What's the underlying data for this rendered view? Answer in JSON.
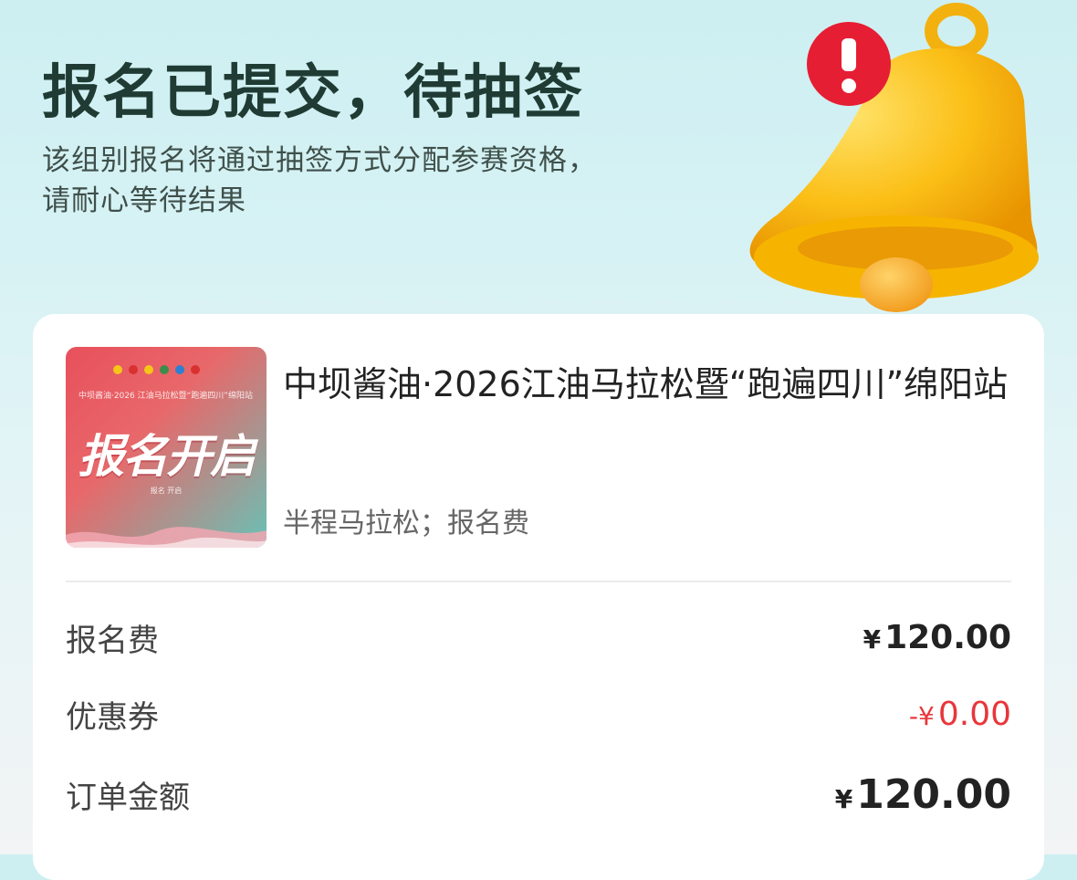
{
  "header": {
    "title": "报名已提交，待抽签",
    "subtitle": "该组别报名将通过抽签方式分配参赛资格，\n请耐心等待结果"
  },
  "bell_icon": {
    "name": "bell-notification-icon",
    "badge": "!"
  },
  "event": {
    "poster_title": "报名开启",
    "poster_subtitle": "中坝酱油·2026 江油马拉松暨“跑遍四川”绵阳站",
    "poster_footer": "报名 开启",
    "name": "中坝酱油·2026江油马拉松暨“跑遍四川”绵阳站",
    "meta": "半程马拉松；报名费"
  },
  "fees": {
    "rows": [
      {
        "label": "报名费",
        "currency": "¥",
        "value": "120.00",
        "style": "normal"
      },
      {
        "label": "优惠券",
        "currency": "-¥",
        "value": "0.00",
        "style": "red"
      },
      {
        "label": "订单金额",
        "currency": "¥",
        "value": "120.00",
        "style": "big"
      }
    ]
  },
  "colors": {
    "accent_red": "#e8363b",
    "title_color": "#1f3b33",
    "bell_yellow": "#f6b400"
  }
}
